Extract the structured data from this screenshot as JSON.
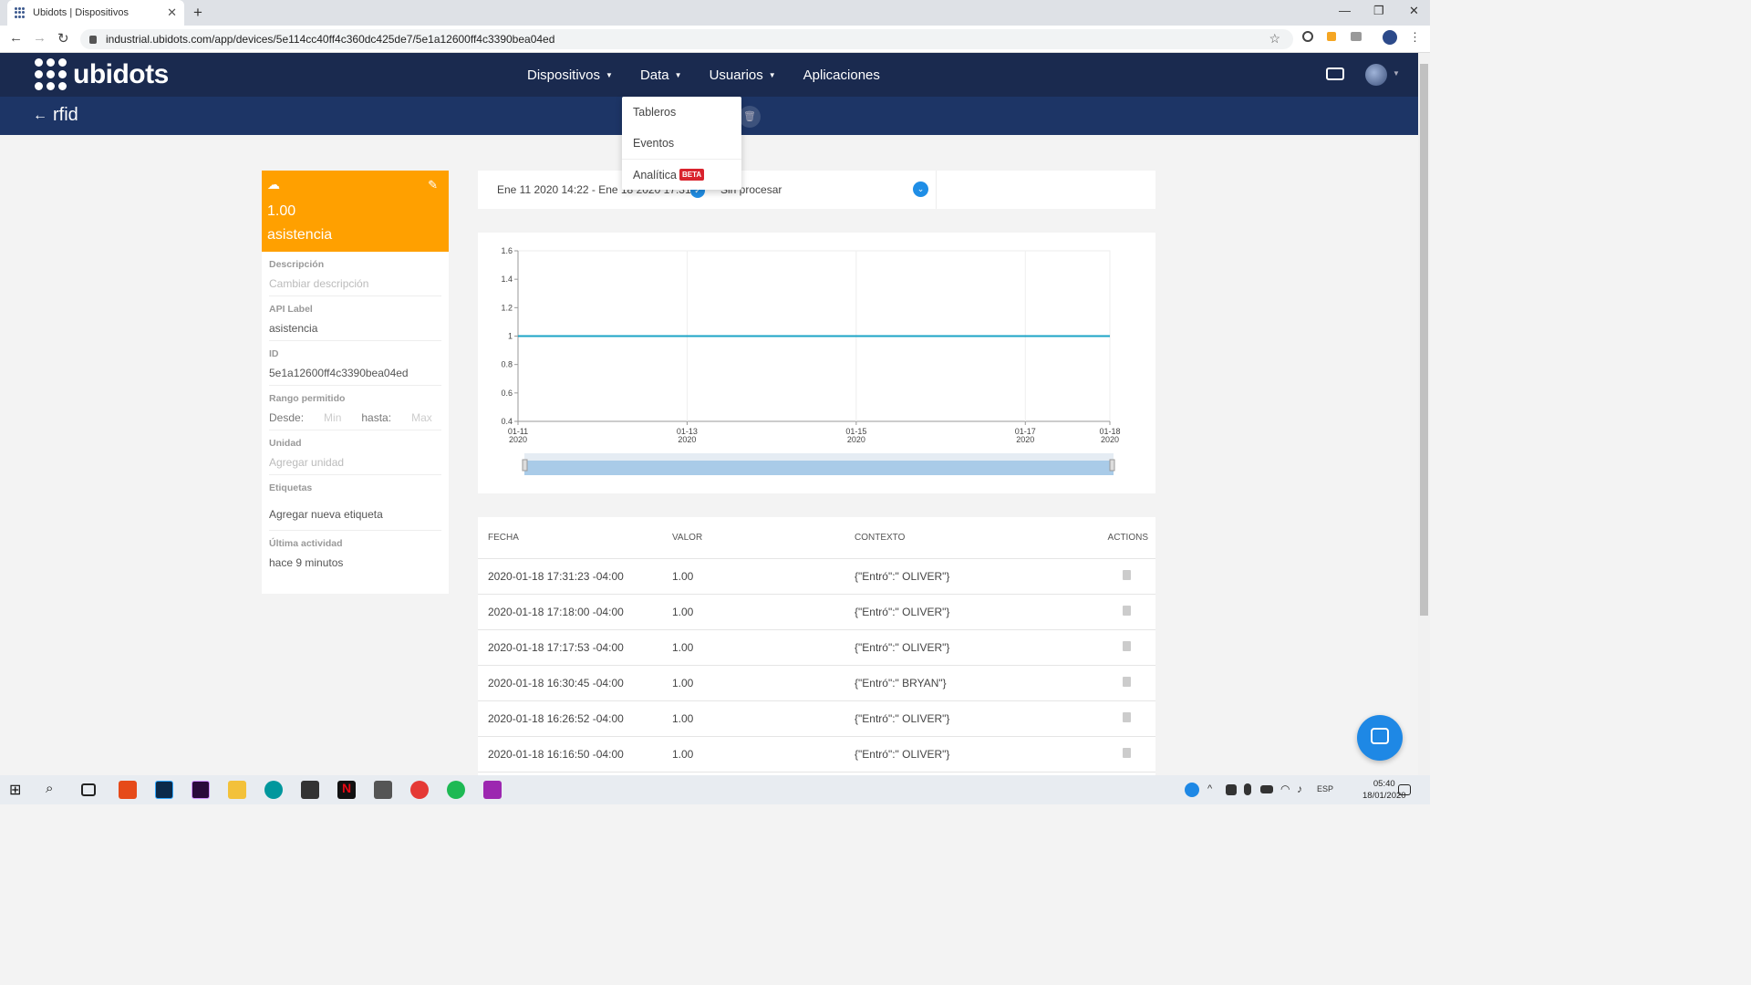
{
  "browser": {
    "tab_title": "Ubidots | Dispositivos",
    "url": "industrial.ubidots.com/app/devices/5e114cc40ff4c360dc425de7/5e1a12600ff4c3390bea04ed"
  },
  "header": {
    "logo_text": "ubidots",
    "nav": [
      {
        "label": "Dispositivos"
      },
      {
        "label": "Data"
      },
      {
        "label": "Usuarios"
      },
      {
        "label": "Aplicaciones"
      }
    ],
    "back_label": "rfid"
  },
  "data_menu": {
    "items": [
      "Tableros",
      "Eventos",
      "Analítica"
    ],
    "beta_badge": "BETA"
  },
  "variable": {
    "value": "1.00",
    "name": "asistencia",
    "description_label": "Descripción",
    "description_placeholder": "Cambiar descripción",
    "api_label_label": "API Label",
    "api_label": "asistencia",
    "id_label": "ID",
    "id": "5e1a12600ff4c3390bea04ed",
    "range_label": "Rango permitido",
    "range_from": "Desde:",
    "range_min": "Min",
    "range_to": "hasta:",
    "range_max": "Max",
    "unit_label": "Unidad",
    "unit_placeholder": "Agregar unidad",
    "tags_label": "Etiquetas",
    "tags_add": "Agregar nueva etiqueta",
    "last_activity_label": "Última actividad",
    "last_activity": "hace 9 minutos"
  },
  "filter": {
    "date_range": "Ene 11 2020 14:22 - Ene 18 2020 17:31",
    "processing": "Sin procesar"
  },
  "chart_data": {
    "type": "line",
    "x": [
      "2020-01-11",
      "2020-01-18"
    ],
    "series": [
      {
        "values": [
          1,
          1
        ]
      }
    ],
    "ylim": [
      0.4,
      1.6
    ],
    "y_ticks": [
      "0.4",
      "0.6",
      "0.8",
      "1",
      "1.2",
      "1.4",
      "1.6"
    ],
    "x_ticks": [
      {
        "date": "01-11",
        "year": "2020"
      },
      {
        "date": "01-13",
        "year": "2020"
      },
      {
        "date": "01-15",
        "year": "2020"
      },
      {
        "date": "01-17",
        "year": "2020"
      },
      {
        "date": "01-18",
        "year": "2020"
      }
    ],
    "grid": true,
    "line_color": "#1ba3c6"
  },
  "table": {
    "headers": [
      "FECHA",
      "VALOR",
      "CONTEXTO",
      "ACTIONS"
    ],
    "rows": [
      {
        "fecha": "2020-01-18 17:31:23 -04:00",
        "valor": "1.00",
        "contexto": "{\"Entró\":\" OLIVER\"}"
      },
      {
        "fecha": "2020-01-18 17:18:00 -04:00",
        "valor": "1.00",
        "contexto": "{\"Entró\":\" OLIVER\"}"
      },
      {
        "fecha": "2020-01-18 17:17:53 -04:00",
        "valor": "1.00",
        "contexto": "{\"Entró\":\" OLIVER\"}"
      },
      {
        "fecha": "2020-01-18 16:30:45 -04:00",
        "valor": "1.00",
        "contexto": "{\"Entró\":\" BRYAN\"}"
      },
      {
        "fecha": "2020-01-18 16:26:52 -04:00",
        "valor": "1.00",
        "contexto": "{\"Entró\":\" OLIVER\"}"
      },
      {
        "fecha": "2020-01-18 16:16:50 -04:00",
        "valor": "1.00",
        "contexto": "{\"Entró\":\" OLIVER\"}"
      }
    ]
  },
  "taskbar": {
    "language": "ESP",
    "time": "05:40",
    "date": "18/01/2020"
  },
  "colors": {
    "header": "#1a2a4f",
    "subheader": "#1d3566",
    "variable_card": "#ffa000",
    "accent": "#1f8ee6",
    "beta": "#d9232d"
  }
}
